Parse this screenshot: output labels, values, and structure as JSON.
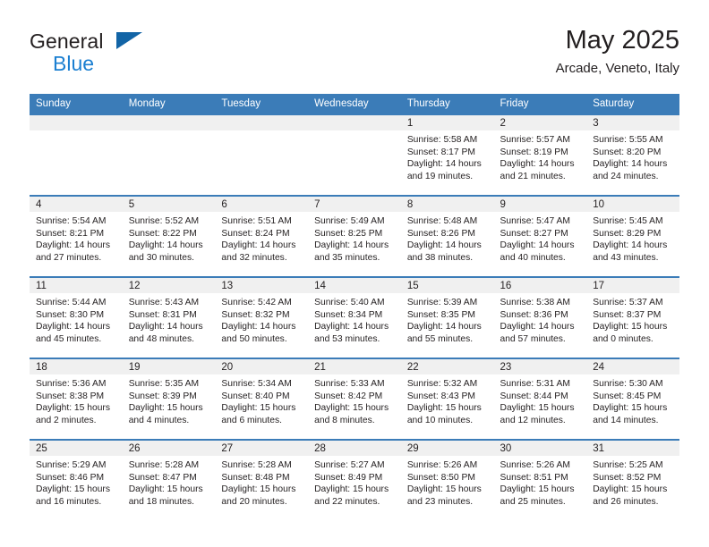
{
  "brand": {
    "name_top": "General",
    "name_bottom": "Blue",
    "triangle_color": "#1264a6",
    "blue_color": "#1b7fd1"
  },
  "header": {
    "title": "May 2025",
    "subtitle": "Arcade, Veneto, Italy",
    "accent_color": "#3b7cb8"
  },
  "calendar": {
    "weekday_headers": [
      "Sunday",
      "Monday",
      "Tuesday",
      "Wednesday",
      "Thursday",
      "Friday",
      "Saturday"
    ],
    "weeks": [
      [
        {
          "empty": true
        },
        {
          "empty": true
        },
        {
          "empty": true
        },
        {
          "empty": true
        },
        {
          "day": "1",
          "sunrise": "Sunrise: 5:58 AM",
          "sunset": "Sunset: 8:17 PM",
          "daylight": "Daylight: 14 hours and 19 minutes."
        },
        {
          "day": "2",
          "sunrise": "Sunrise: 5:57 AM",
          "sunset": "Sunset: 8:19 PM",
          "daylight": "Daylight: 14 hours and 21 minutes."
        },
        {
          "day": "3",
          "sunrise": "Sunrise: 5:55 AM",
          "sunset": "Sunset: 8:20 PM",
          "daylight": "Daylight: 14 hours and 24 minutes."
        }
      ],
      [
        {
          "day": "4",
          "sunrise": "Sunrise: 5:54 AM",
          "sunset": "Sunset: 8:21 PM",
          "daylight": "Daylight: 14 hours and 27 minutes."
        },
        {
          "day": "5",
          "sunrise": "Sunrise: 5:52 AM",
          "sunset": "Sunset: 8:22 PM",
          "daylight": "Daylight: 14 hours and 30 minutes."
        },
        {
          "day": "6",
          "sunrise": "Sunrise: 5:51 AM",
          "sunset": "Sunset: 8:24 PM",
          "daylight": "Daylight: 14 hours and 32 minutes."
        },
        {
          "day": "7",
          "sunrise": "Sunrise: 5:49 AM",
          "sunset": "Sunset: 8:25 PM",
          "daylight": "Daylight: 14 hours and 35 minutes."
        },
        {
          "day": "8",
          "sunrise": "Sunrise: 5:48 AM",
          "sunset": "Sunset: 8:26 PM",
          "daylight": "Daylight: 14 hours and 38 minutes."
        },
        {
          "day": "9",
          "sunrise": "Sunrise: 5:47 AM",
          "sunset": "Sunset: 8:27 PM",
          "daylight": "Daylight: 14 hours and 40 minutes."
        },
        {
          "day": "10",
          "sunrise": "Sunrise: 5:45 AM",
          "sunset": "Sunset: 8:29 PM",
          "daylight": "Daylight: 14 hours and 43 minutes."
        }
      ],
      [
        {
          "day": "11",
          "sunrise": "Sunrise: 5:44 AM",
          "sunset": "Sunset: 8:30 PM",
          "daylight": "Daylight: 14 hours and 45 minutes."
        },
        {
          "day": "12",
          "sunrise": "Sunrise: 5:43 AM",
          "sunset": "Sunset: 8:31 PM",
          "daylight": "Daylight: 14 hours and 48 minutes."
        },
        {
          "day": "13",
          "sunrise": "Sunrise: 5:42 AM",
          "sunset": "Sunset: 8:32 PM",
          "daylight": "Daylight: 14 hours and 50 minutes."
        },
        {
          "day": "14",
          "sunrise": "Sunrise: 5:40 AM",
          "sunset": "Sunset: 8:34 PM",
          "daylight": "Daylight: 14 hours and 53 minutes."
        },
        {
          "day": "15",
          "sunrise": "Sunrise: 5:39 AM",
          "sunset": "Sunset: 8:35 PM",
          "daylight": "Daylight: 14 hours and 55 minutes."
        },
        {
          "day": "16",
          "sunrise": "Sunrise: 5:38 AM",
          "sunset": "Sunset: 8:36 PM",
          "daylight": "Daylight: 14 hours and 57 minutes."
        },
        {
          "day": "17",
          "sunrise": "Sunrise: 5:37 AM",
          "sunset": "Sunset: 8:37 PM",
          "daylight": "Daylight: 15 hours and 0 minutes."
        }
      ],
      [
        {
          "day": "18",
          "sunrise": "Sunrise: 5:36 AM",
          "sunset": "Sunset: 8:38 PM",
          "daylight": "Daylight: 15 hours and 2 minutes."
        },
        {
          "day": "19",
          "sunrise": "Sunrise: 5:35 AM",
          "sunset": "Sunset: 8:39 PM",
          "daylight": "Daylight: 15 hours and 4 minutes."
        },
        {
          "day": "20",
          "sunrise": "Sunrise: 5:34 AM",
          "sunset": "Sunset: 8:40 PM",
          "daylight": "Daylight: 15 hours and 6 minutes."
        },
        {
          "day": "21",
          "sunrise": "Sunrise: 5:33 AM",
          "sunset": "Sunset: 8:42 PM",
          "daylight": "Daylight: 15 hours and 8 minutes."
        },
        {
          "day": "22",
          "sunrise": "Sunrise: 5:32 AM",
          "sunset": "Sunset: 8:43 PM",
          "daylight": "Daylight: 15 hours and 10 minutes."
        },
        {
          "day": "23",
          "sunrise": "Sunrise: 5:31 AM",
          "sunset": "Sunset: 8:44 PM",
          "daylight": "Daylight: 15 hours and 12 minutes."
        },
        {
          "day": "24",
          "sunrise": "Sunrise: 5:30 AM",
          "sunset": "Sunset: 8:45 PM",
          "daylight": "Daylight: 15 hours and 14 minutes."
        }
      ],
      [
        {
          "day": "25",
          "sunrise": "Sunrise: 5:29 AM",
          "sunset": "Sunset: 8:46 PM",
          "daylight": "Daylight: 15 hours and 16 minutes."
        },
        {
          "day": "26",
          "sunrise": "Sunrise: 5:28 AM",
          "sunset": "Sunset: 8:47 PM",
          "daylight": "Daylight: 15 hours and 18 minutes."
        },
        {
          "day": "27",
          "sunrise": "Sunrise: 5:28 AM",
          "sunset": "Sunset: 8:48 PM",
          "daylight": "Daylight: 15 hours and 20 minutes."
        },
        {
          "day": "28",
          "sunrise": "Sunrise: 5:27 AM",
          "sunset": "Sunset: 8:49 PM",
          "daylight": "Daylight: 15 hours and 22 minutes."
        },
        {
          "day": "29",
          "sunrise": "Sunrise: 5:26 AM",
          "sunset": "Sunset: 8:50 PM",
          "daylight": "Daylight: 15 hours and 23 minutes."
        },
        {
          "day": "30",
          "sunrise": "Sunrise: 5:26 AM",
          "sunset": "Sunset: 8:51 PM",
          "daylight": "Daylight: 15 hours and 25 minutes."
        },
        {
          "day": "31",
          "sunrise": "Sunrise: 5:25 AM",
          "sunset": "Sunset: 8:52 PM",
          "daylight": "Daylight: 15 hours and 26 minutes."
        }
      ]
    ]
  }
}
